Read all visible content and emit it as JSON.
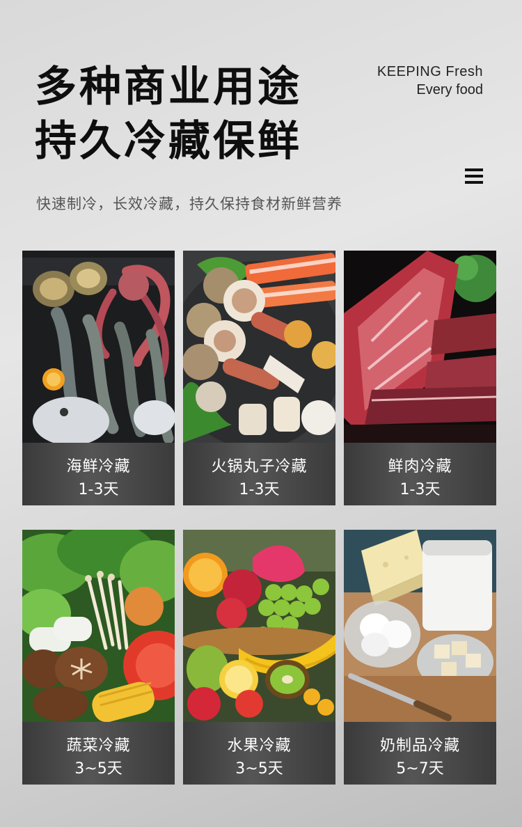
{
  "header": {
    "title_line1": "多种商业用途",
    "title_line2": "持久冷藏保鲜",
    "brand_line1": "KEEPING Fresh",
    "brand_line2": "Every food",
    "subtitle": "快速制冷，长效冷藏，持久保持食材新鲜营养",
    "menu_icon": "menu-icon"
  },
  "cards": [
    {
      "name": "海鲜冷藏",
      "days": "1-3天",
      "image": "seafood-photo"
    },
    {
      "name": "火锅丸子冷藏",
      "days": "1-3天",
      "image": "hotpot-balls-photo"
    },
    {
      "name": "鲜肉冷藏",
      "days": "1-3天",
      "image": "fresh-meat-photo"
    },
    {
      "name": "蔬菜冷藏",
      "days": "3~5天",
      "image": "vegetables-photo"
    },
    {
      "name": "水果冷藏",
      "days": "3~5天",
      "image": "fruit-photo"
    },
    {
      "name": "奶制品冷藏",
      "days": "5~7天",
      "image": "dairy-photo"
    }
  ],
  "colors": {
    "background": "#dcdcdc",
    "title_text": "#0e0e0e",
    "card_label_bg": "#444444",
    "card_label_text": "#ffffff"
  }
}
